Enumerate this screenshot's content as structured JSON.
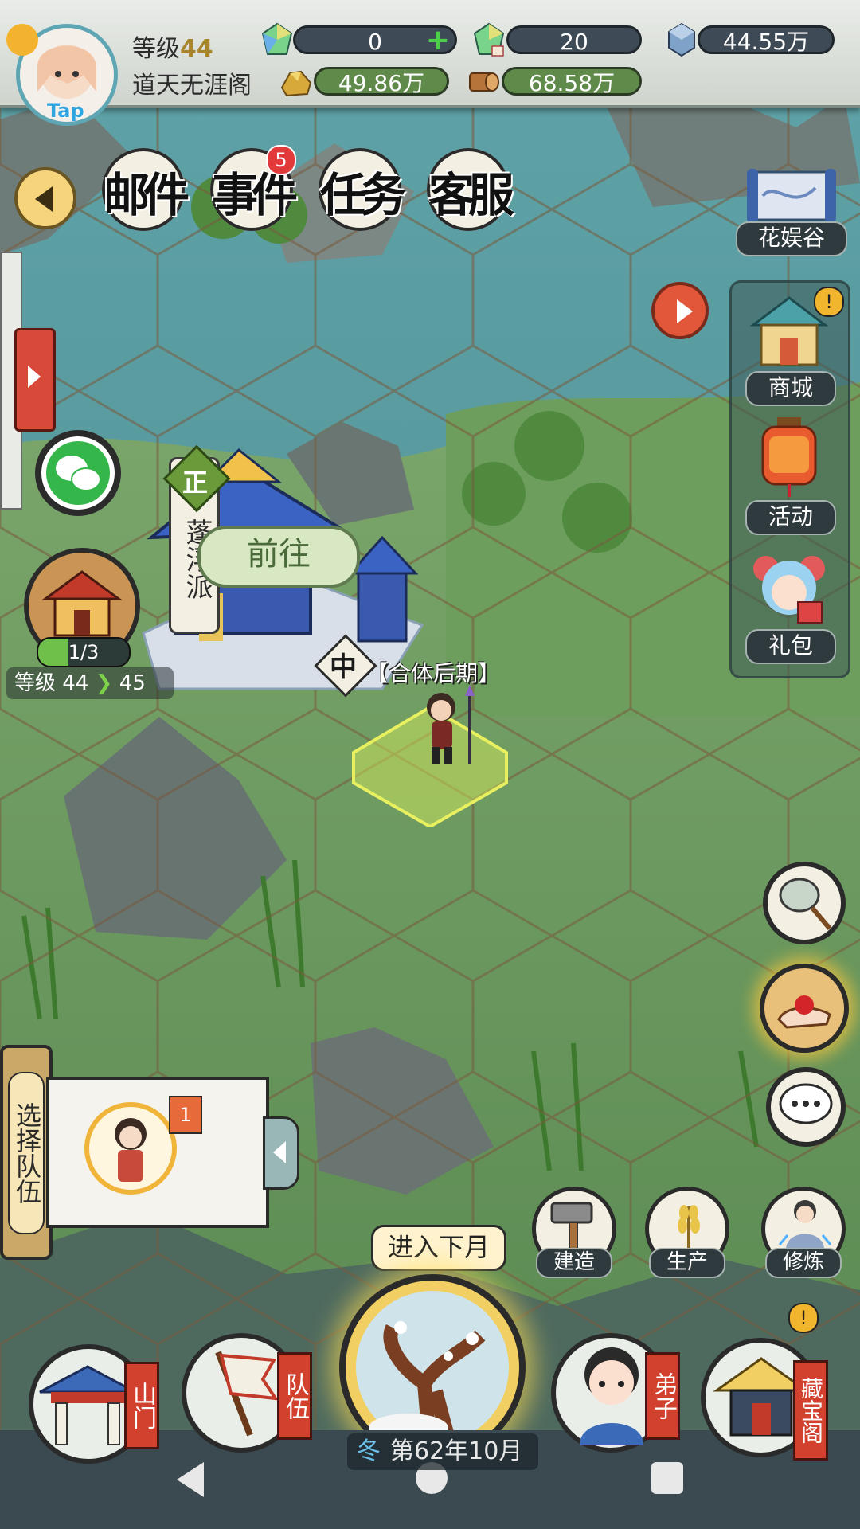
{
  "player": {
    "level_label": "等级",
    "level_value": "44",
    "name": "道天无涯阁",
    "avatar_tag": "Tap"
  },
  "resources": {
    "gem_a": "0",
    "gem_b": "20",
    "crystal": "44.55万",
    "gold": "49.86万",
    "wood": "68.58万"
  },
  "top_buttons": {
    "mail": "邮件",
    "events": "事件",
    "events_badge": "5",
    "tasks": "任务",
    "service": "客服"
  },
  "right_menu": {
    "valley": "花娱谷",
    "shop": "商城",
    "activity": "活动",
    "gift": "礼包"
  },
  "sect": {
    "faction_mark": "正",
    "name": "蓬浮派",
    "goto_button": "前往",
    "progress": "1/3",
    "level_from_label": "等级 44",
    "level_to": "45",
    "center_mark": "中",
    "stage_tag": "【合体后期】"
  },
  "team_panel": {
    "title": "选择队伍",
    "slot_badge": "1"
  },
  "action_buttons": {
    "build": "建造",
    "produce": "生产",
    "cultivate": "修炼"
  },
  "next_month": {
    "bubble": "进入下月",
    "season": "冬",
    "date": "第62年10月"
  },
  "bottom_nav": {
    "gate": "山门",
    "team": "队伍",
    "disciple": "弟子",
    "treasure": "藏宝阁"
  },
  "colors": {
    "accent_gold": "#e8b43a",
    "badge_red": "#e23a3a",
    "grass": "#6a9a5a",
    "water": "#5f9fa4"
  }
}
